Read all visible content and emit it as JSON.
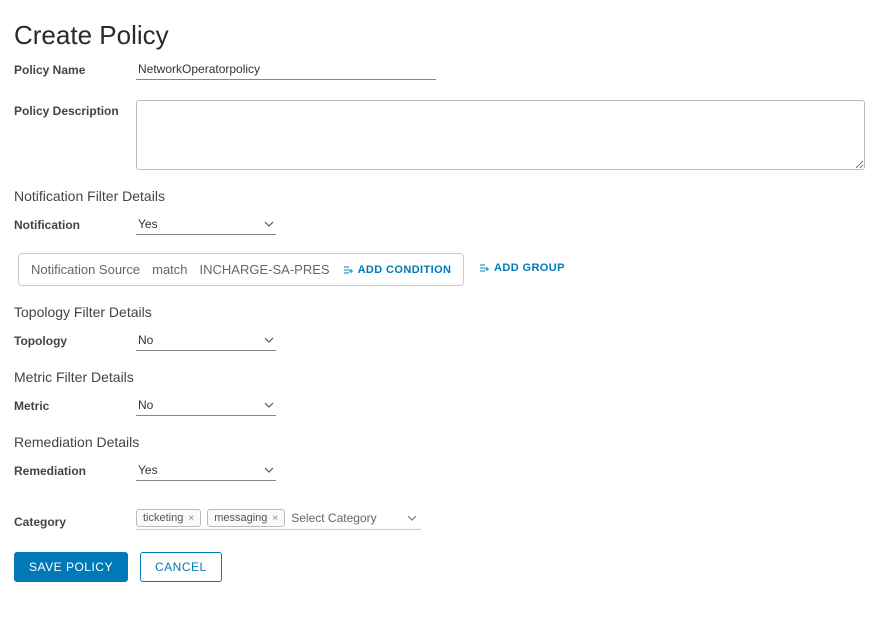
{
  "page_title": "Create Policy",
  "labels": {
    "policy_name": "Policy Name",
    "policy_description": "Policy Description",
    "notification": "Notification",
    "topology": "Topology",
    "metric": "Metric",
    "remediation": "Remediation",
    "category": "Category"
  },
  "sections": {
    "notification_filter": "Notification Filter Details",
    "topology_filter": "Topology Filter Details",
    "metric_filter": "Metric Filter Details",
    "remediation_details": "Remediation Details"
  },
  "values": {
    "policy_name": "NetworkOperatorpolicy",
    "policy_description": "",
    "notification_select": "Yes",
    "topology_select": "No",
    "metric_select": "No",
    "remediation_select": "Yes",
    "category_placeholder": "Select Category"
  },
  "condition": {
    "field": "Notification Source",
    "op": "match",
    "value": "INCHARGE-SA-PRES"
  },
  "actions": {
    "add_condition": "ADD CONDITION",
    "add_group": "ADD GROUP",
    "save": "SAVE POLICY",
    "cancel": "CANCEL"
  },
  "tags": {
    "t1": "ticketing",
    "t2": "messaging"
  }
}
